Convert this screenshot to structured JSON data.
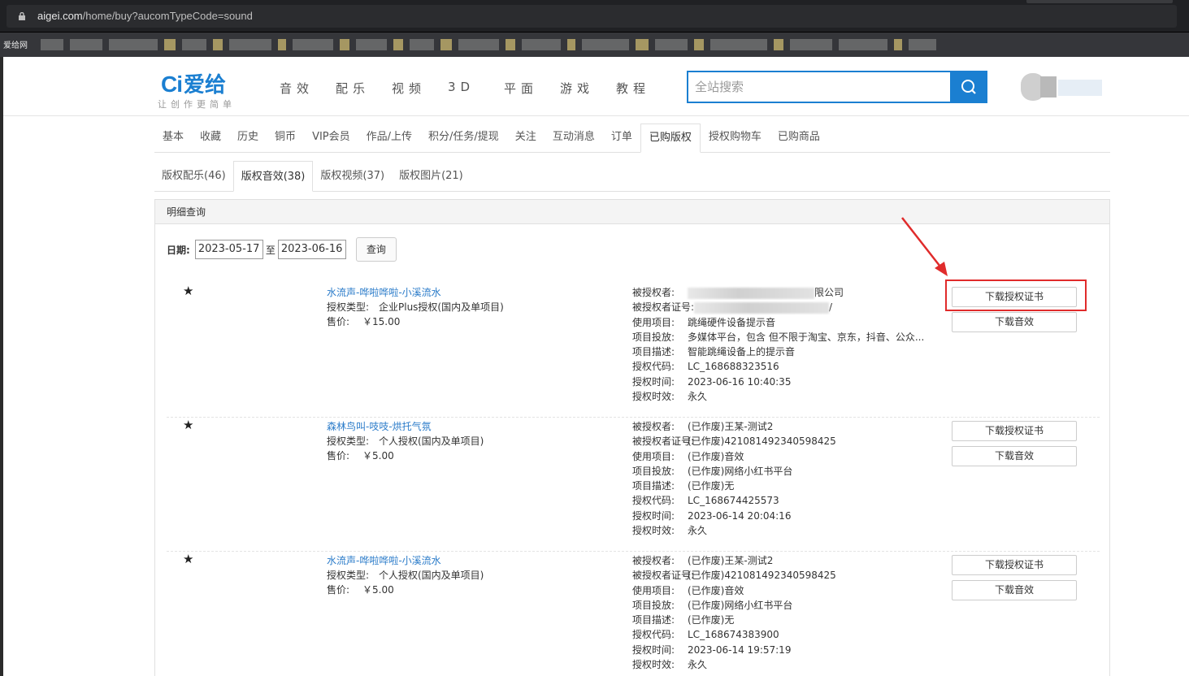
{
  "browser": {
    "url_domain": "aigei.com",
    "url_path": "/home/buy?aucomTypeCode=sound",
    "bookmark_first": "爱给网"
  },
  "site": {
    "logo_mark": "Ci",
    "logo_name": "爱给",
    "slogan": "让创作更简单",
    "nav": [
      "音效",
      "配乐",
      "视频",
      "3D",
      "平面",
      "游戏",
      "教程"
    ],
    "search_placeholder": "全站搜索",
    "accent_color": "#1b7fd1"
  },
  "account_tabs": [
    "基本",
    "收藏",
    "历史",
    "铜币",
    "VIP会员",
    "作品/上传",
    "积分/任务/提现",
    "关注",
    "互动消息",
    "订单",
    "已购版权",
    "授权购物车",
    "已购商品"
  ],
  "account_tab_active": "已购版权",
  "sub_tabs": [
    "版权配乐(46)",
    "版权音效(38)",
    "版权视频(37)",
    "版权图片(21)"
  ],
  "sub_tab_active": "版权音效(38)",
  "panel": {
    "heading": "明细查询",
    "date_label": "日期:",
    "date_from": "2023-05-17",
    "to_label": "至",
    "date_to": "2023-06-16",
    "query_button": "查询"
  },
  "orders": [
    {
      "star": "★",
      "title": "水流声-哗啦哗啦-小溪流水",
      "license_type_label": "授权类型:",
      "license_type": "企业Plus授权(国内及单项目)",
      "price_label": "售价:",
      "price": "￥15.00",
      "licensee_label": "被授权者:",
      "licensee": "限公司",
      "licensee_id_label": "被授权者证号:",
      "licensee_id": "/",
      "project_label": "使用项目:",
      "project": "跳绳硬件设备提示音",
      "channel_label": "项目投放:",
      "channel": "多媒体平台，包含 但不限于淘宝、京东，抖音、公众...",
      "desc_label": "项目描述:",
      "desc": "智能跳绳设备上的提示音",
      "code_label": "授权代码:",
      "code": "LC_168688323516",
      "time_label": "授权时间:",
      "time": "2023-06-16 10:40:35",
      "validity_label": "授权时效:",
      "validity": "永久",
      "cert_button": "下载授权证书",
      "download_button": "下载音效"
    },
    {
      "star": "★",
      "title": "森林鸟叫-吱吱-烘托气氛",
      "license_type_label": "授权类型:",
      "license_type": "个人授权(国内及单项目)",
      "price_label": "售价:",
      "price": "￥5.00",
      "licensee_label": "被授权者:",
      "licensee": "(已作废)王某-测试2",
      "licensee_id_label": "被授权者证号:",
      "licensee_id": "(已作废)421081492340598425",
      "project_label": "使用项目:",
      "project": "(已作废)音效",
      "channel_label": "项目投放:",
      "channel": "(已作废)网络小红书平台",
      "desc_label": "项目描述:",
      "desc": "(已作废)无",
      "code_label": "授权代码:",
      "code": "LC_168674425573",
      "time_label": "授权时间:",
      "time": "2023-06-14 20:04:16",
      "validity_label": "授权时效:",
      "validity": "永久",
      "cert_button": "下载授权证书",
      "download_button": "下载音效"
    },
    {
      "star": "★",
      "title": "水流声-哗啦哗啦-小溪流水",
      "license_type_label": "授权类型:",
      "license_type": "个人授权(国内及单项目)",
      "price_label": "售价:",
      "price": "￥5.00",
      "licensee_label": "被授权者:",
      "licensee": "(已作废)王某-测试2",
      "licensee_id_label": "被授权者证号:",
      "licensee_id": "(已作废)421081492340598425",
      "project_label": "使用项目:",
      "project": "(已作废)音效",
      "channel_label": "项目投放:",
      "channel": "(已作废)网络小红书平台",
      "desc_label": "项目描述:",
      "desc": "(已作废)无",
      "code_label": "授权代码:",
      "code": "LC_168674383900",
      "time_label": "授权时间:",
      "time": "2023-06-14 19:57:19",
      "validity_label": "授权时效:",
      "validity": "永久",
      "cert_button": "下载授权证书",
      "download_button": "下载音效"
    }
  ]
}
